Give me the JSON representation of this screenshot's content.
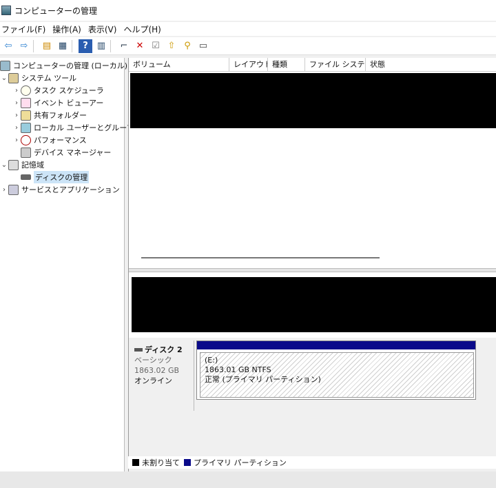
{
  "window": {
    "title": "コンピューターの管理"
  },
  "menu": [
    "ファイル(F)",
    "操作(A)",
    "表示(V)",
    "ヘルプ(H)"
  ],
  "toolbar": [
    {
      "icon": "back-arrow-icon",
      "glyph": "⇦"
    },
    {
      "icon": "forward-arrow-icon",
      "glyph": "⇨"
    },
    {
      "icon": "up-folder-icon",
      "glyph": "▤"
    },
    {
      "icon": "show-hide-tree-icon",
      "glyph": "▦"
    },
    {
      "icon": "help-icon",
      "glyph": "?"
    },
    {
      "icon": "action-pane-icon",
      "glyph": "▥"
    },
    {
      "icon": "connect-icon",
      "glyph": "⌐"
    },
    {
      "icon": "delete-icon",
      "glyph": "✕"
    },
    {
      "icon": "properties-icon",
      "glyph": "☑"
    },
    {
      "icon": "import-icon",
      "glyph": "⇧"
    },
    {
      "icon": "search-icon",
      "glyph": "⚲"
    },
    {
      "icon": "console-icon",
      "glyph": "▭"
    }
  ],
  "tree": {
    "root": "コンピューターの管理 (ローカル)",
    "system_tools": "システム ツール",
    "task_scheduler": "タスク スケジューラ",
    "event_viewer": "イベント ビューアー",
    "shared_folders": "共有フォルダー",
    "local_users": "ローカル ユーザーとグループ",
    "performance": "パフォーマンス",
    "device_manager": "デバイス マネージャー",
    "storage": "記憶域",
    "disk_management": "ディスクの管理",
    "services_apps": "サービスとアプリケーション"
  },
  "columns": [
    "ボリューム",
    "レイアウト",
    "種類",
    "ファイル システム",
    "状態"
  ],
  "disk": {
    "name": "ディスク 2",
    "type": "ベーシック",
    "size": "1863.02 GB",
    "status": "オンライン"
  },
  "partition": {
    "drive": "(E:)",
    "size_fs": "1863.01 GB NTFS",
    "status": "正常 (プライマリ パーティション)"
  },
  "legend": {
    "unallocated": "未割り当て",
    "primary": "プライマリ パーティション",
    "unallocated_color": "#000000",
    "primary_color": "#0a0a8a"
  }
}
